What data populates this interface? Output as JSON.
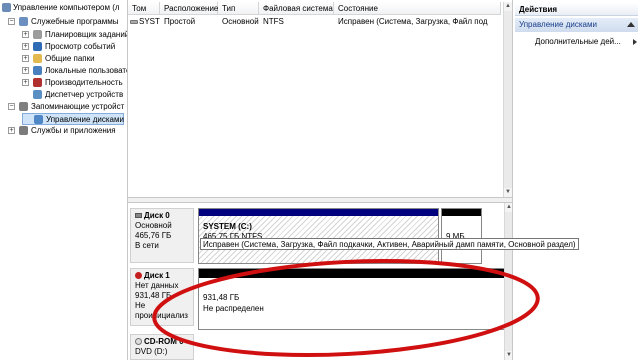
{
  "tree": {
    "root": "Управление компьютером (л",
    "items": [
      {
        "label": "Служебные программы",
        "expander": "-",
        "icon": "tools-icon",
        "color": "#6b8fbf"
      },
      {
        "label": "Планировщик заданий",
        "expander": "+",
        "icon": "clock-icon",
        "color": "#9c9c9c"
      },
      {
        "label": "Просмотр событий",
        "expander": "+",
        "icon": "event-viewer-icon",
        "color": "#2e6db5"
      },
      {
        "label": "Общие папки",
        "expander": "+",
        "icon": "shared-folder-icon",
        "color": "#e2b94e"
      },
      {
        "label": "Локальные пользовате",
        "expander": "+",
        "icon": "users-icon",
        "color": "#4a7fbf"
      },
      {
        "label": "Производительность",
        "expander": "+",
        "icon": "performance-icon",
        "color": "#b03030"
      },
      {
        "label": "Диспетчер устройств",
        "expander": "",
        "icon": "device-manager-icon",
        "color": "#5a8fc4"
      },
      {
        "label": "Запоминающие устройст",
        "expander": "-",
        "icon": "storage-icon",
        "color": "#7f7f7f"
      },
      {
        "label": "Управление дисками",
        "expander": "",
        "icon": "disk-management-icon",
        "color": "#4f86c6"
      },
      {
        "label": "Службы и приложения",
        "expander": "+",
        "icon": "services-icon",
        "color": "#7b7b7b"
      }
    ]
  },
  "volume_list": {
    "headers": [
      "Том",
      "Расположение",
      "Тип",
      "Файловая система",
      "Состояние"
    ],
    "rows": [
      {
        "name": "SYSTEM (C:)",
        "layout": "Простой",
        "type": "Основной",
        "fs": "NTFS",
        "status": "Исправен (Система, Загрузка, Файл под"
      }
    ]
  },
  "disks": [
    {
      "title": "Диск 0",
      "kind": "Основной",
      "size": "465,76 ГБ",
      "state": "В сети",
      "volume_name": "SYSTEM  (C:)",
      "volume_size": "465,75 ГБ NTFS",
      "volume_status": "Исправен (Система, Загрузка, Файл подкачки, Активен, Аварийный дамп памяти, Основной раздел)",
      "small_partition": "9 МБ"
    },
    {
      "title": "Диск 1",
      "kind": "Нет данных",
      "size": "931,48 ГБ",
      "state": "Не проинициализ",
      "unalloc_size": "931,48 ГБ",
      "unalloc_label": "Не распределен"
    },
    {
      "title": "CD-ROM 0",
      "kind": "DVD (D:)"
    }
  ],
  "actions": {
    "header": "Действия",
    "section": "Управление дисками",
    "item": "Дополнительные дей..."
  },
  "colors": {
    "primary_partition": "#00007f",
    "unallocated": "#000000",
    "annotation": "#d01010"
  }
}
